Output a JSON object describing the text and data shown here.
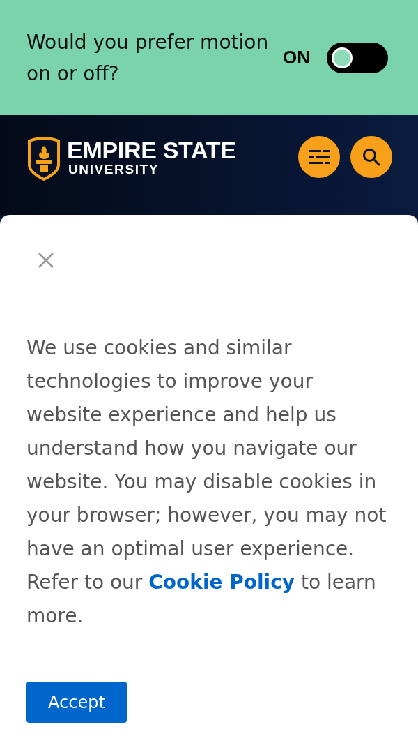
{
  "motion_banner": {
    "question": "Would you prefer motion on or off?",
    "state_label": "ON",
    "switch": {
      "checked": false
    }
  },
  "header": {
    "logo": {
      "title": "EMPIRE STATE",
      "subtitle": "UNIVERSITY"
    },
    "buttons": [
      {
        "kind": "menu"
      },
      {
        "kind": "search"
      }
    ]
  },
  "cookie_dialog": {
    "message_before": "We use cookies and similar technologies to improve your website experience and help us understand how you navigate our website. You may disable cookies in your browser; however, you may not have an optimal user experience. Refer to our",
    "link": "Cookie Policy",
    "message_after": "to learn more.",
    "accept_button": "Accept"
  }
}
